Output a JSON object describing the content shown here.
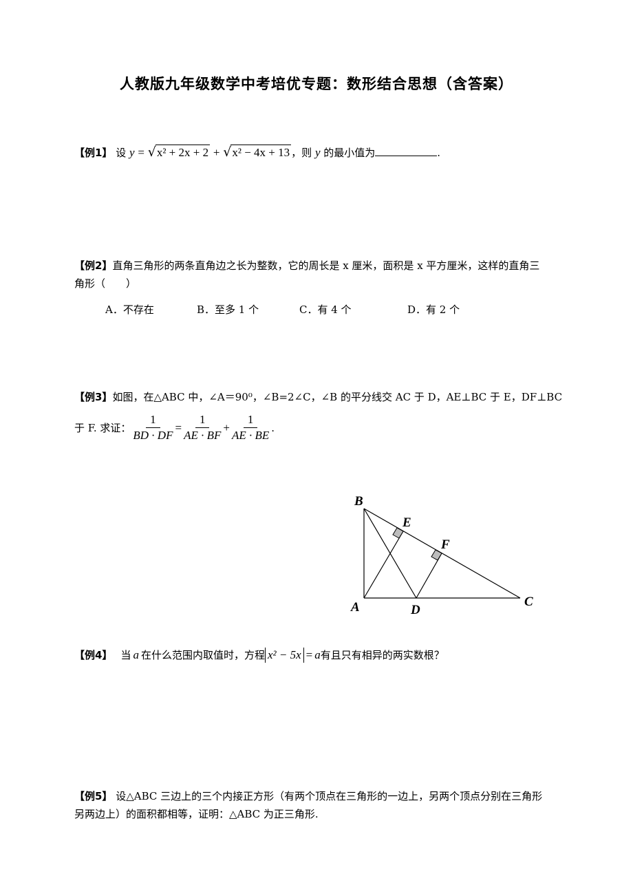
{
  "title": "人教版九年级数学中考培优专题：数形结合思想（含答案）",
  "examples": [
    {
      "tag": "【例1】",
      "prefix": "设",
      "var_y": "y",
      "eq": "=",
      "rad1": "x² + 2x + 2",
      "plus": "+",
      "rad2": "x² − 4x + 13",
      "suffix1": "，则",
      "suffix_y": "y",
      "suffix2": "的最小值为",
      "end": "."
    },
    {
      "tag": "【例2】",
      "line1": "直角三角形的两条直角边之长为整数，它的周长是 x 厘米，面积是 x 平方厘米，这样的直角三",
      "line2": "角形（　　）",
      "options": [
        {
          "label": "A．不存在"
        },
        {
          "label": "B．至多 1 个"
        },
        {
          "label": "C．有 4 个"
        },
        {
          "label": "D．有 2 个"
        }
      ]
    },
    {
      "tag": "【例3】",
      "line1": "如图，在△ABC 中，∠A＝90⁰，∠B=2∠C，∠B 的平分线交 AC 于 D，AE⊥BC 于 E，DF⊥BC",
      "line2_prefix": "于 F.  求证：",
      "frac1": {
        "num": "1",
        "den": "BD · DF"
      },
      "eq": "=",
      "frac2": {
        "num": "1",
        "den": "AE · BF"
      },
      "plus": "+",
      "frac3": {
        "num": "1",
        "den": "AE · BE"
      },
      "end": ".",
      "figure": {
        "labels": {
          "A": "A",
          "B": "B",
          "C": "C",
          "D": "D",
          "E": "E",
          "F": "F"
        }
      }
    },
    {
      "tag": "【例4】",
      "prefix": "当",
      "var_a": "a",
      "mid": "在什么范围内取值时，方程",
      "abs_expr": "x² − 5x",
      "eq": "=",
      "rhs": "a",
      "suffix": "有且只有相异的两实数根？"
    },
    {
      "tag": "【例5】",
      "line1": "设△ABC 三边上的三个内接正方形（有两个顶点在三角形的一边上，另两个顶点分别在三角形",
      "line2": "另两边上）的面积都相等，证明：△ABC 为正三角形."
    }
  ]
}
